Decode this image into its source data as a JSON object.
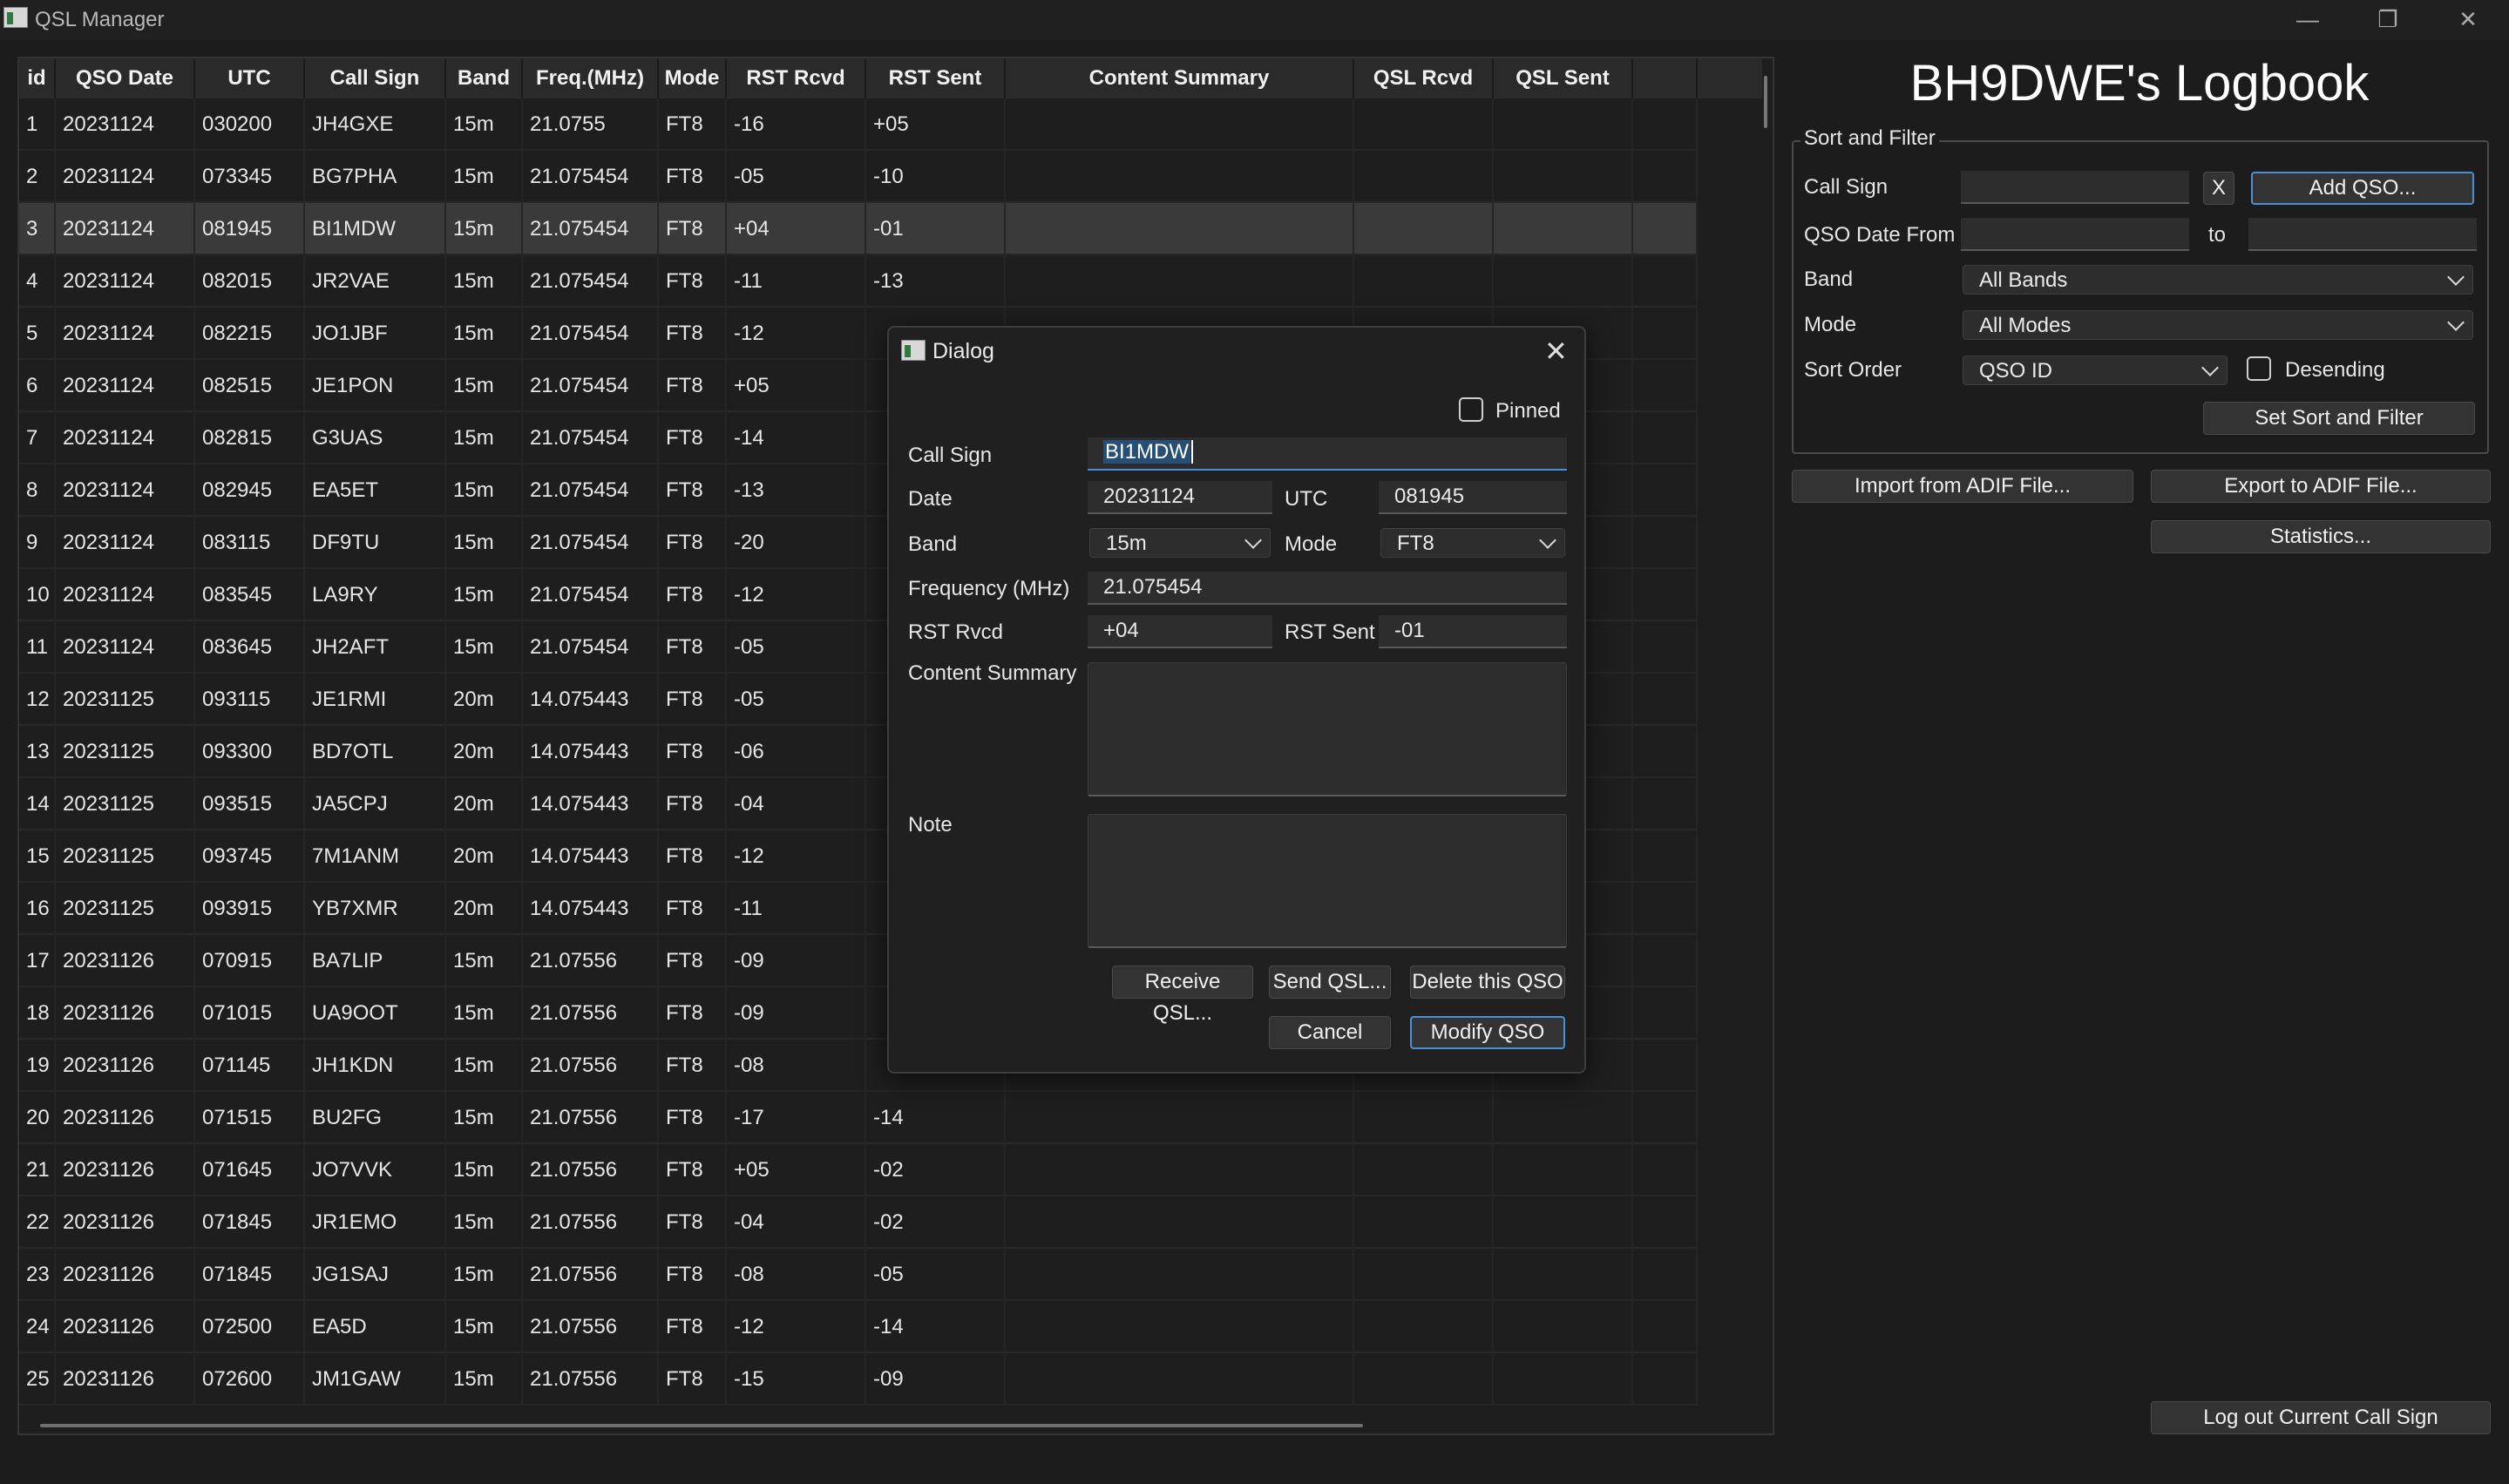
{
  "window": {
    "title": "QSL Manager",
    "minimize_glyph": "—",
    "restore_glyph": "❐",
    "close_glyph": "✕"
  },
  "table": {
    "columns": [
      "id",
      "QSO Date",
      "UTC",
      "Call Sign",
      "Band",
      "Freq.(MHz)",
      "Mode",
      "RST Rcvd",
      "RST Sent",
      "Content Summary",
      "QSL Rcvd",
      "QSL Sent"
    ],
    "rows": [
      [
        "1",
        "20231124",
        "030200",
        "JH4GXE",
        "15m",
        "21.0755",
        "FT8",
        "-16",
        "+05"
      ],
      [
        "2",
        "20231124",
        "073345",
        "BG7PHA",
        "15m",
        "21.075454",
        "FT8",
        "-05",
        "-10"
      ],
      [
        "3",
        "20231124",
        "081945",
        "BI1MDW",
        "15m",
        "21.075454",
        "FT8",
        "+04",
        "-01"
      ],
      [
        "4",
        "20231124",
        "082015",
        "JR2VAE",
        "15m",
        "21.075454",
        "FT8",
        "-11",
        "-13"
      ],
      [
        "5",
        "20231124",
        "082215",
        "JO1JBF",
        "15m",
        "21.075454",
        "FT8",
        "-12",
        ""
      ],
      [
        "6",
        "20231124",
        "082515",
        "JE1PON",
        "15m",
        "21.075454",
        "FT8",
        "+05",
        ""
      ],
      [
        "7",
        "20231124",
        "082815",
        "G3UAS",
        "15m",
        "21.075454",
        "FT8",
        "-14",
        ""
      ],
      [
        "8",
        "20231124",
        "082945",
        "EA5ET",
        "15m",
        "21.075454",
        "FT8",
        "-13",
        ""
      ],
      [
        "9",
        "20231124",
        "083115",
        "DF9TU",
        "15m",
        "21.075454",
        "FT8",
        "-20",
        ""
      ],
      [
        "10",
        "20231124",
        "083545",
        "LA9RY",
        "15m",
        "21.075454",
        "FT8",
        "-12",
        ""
      ],
      [
        "11",
        "20231124",
        "083645",
        "JH2AFT",
        "15m",
        "21.075454",
        "FT8",
        "-05",
        ""
      ],
      [
        "12",
        "20231125",
        "093115",
        "JE1RMI",
        "20m",
        "14.075443",
        "FT8",
        "-05",
        ""
      ],
      [
        "13",
        "20231125",
        "093300",
        "BD7OTL",
        "20m",
        "14.075443",
        "FT8",
        "-06",
        ""
      ],
      [
        "14",
        "20231125",
        "093515",
        "JA5CPJ",
        "20m",
        "14.075443",
        "FT8",
        "-04",
        ""
      ],
      [
        "15",
        "20231125",
        "093745",
        "7M1ANM",
        "20m",
        "14.075443",
        "FT8",
        "-12",
        ""
      ],
      [
        "16",
        "20231125",
        "093915",
        "YB7XMR",
        "20m",
        "14.075443",
        "FT8",
        "-11",
        ""
      ],
      [
        "17",
        "20231126",
        "070915",
        "BA7LIP",
        "15m",
        "21.07556",
        "FT8",
        "-09",
        ""
      ],
      [
        "18",
        "20231126",
        "071015",
        "UA9OOT",
        "15m",
        "21.07556",
        "FT8",
        "-09",
        ""
      ],
      [
        "19",
        "20231126",
        "071145",
        "JH1KDN",
        "15m",
        "21.07556",
        "FT8",
        "-08",
        ""
      ],
      [
        "20",
        "20231126",
        "071515",
        "BU2FG",
        "15m",
        "21.07556",
        "FT8",
        "-17",
        "-14"
      ],
      [
        "21",
        "20231126",
        "071645",
        "JO7VVK",
        "15m",
        "21.07556",
        "FT8",
        "+05",
        "-02"
      ],
      [
        "22",
        "20231126",
        "071845",
        "JR1EMO",
        "15m",
        "21.07556",
        "FT8",
        "-04",
        "-02"
      ],
      [
        "23",
        "20231126",
        "071845",
        "JG1SAJ",
        "15m",
        "21.07556",
        "FT8",
        "-08",
        "-05"
      ],
      [
        "24",
        "20231126",
        "072500",
        "EA5D",
        "15m",
        "21.07556",
        "FT8",
        "-12",
        "-14"
      ],
      [
        "25",
        "20231126",
        "072600",
        "JM1GAW",
        "15m",
        "21.07556",
        "FT8",
        "-15",
        "-09"
      ]
    ],
    "selected_row": 3
  },
  "panel": {
    "logbook_title": "BH9DWE's Logbook",
    "sort_filter_title": "Sort and Filter",
    "call_sign_label": "Call Sign",
    "call_sign_value": "",
    "clear_label": "X",
    "add_qso_label": "Add QSO...",
    "date_from_label": "QSO Date From",
    "date_to_label": "to",
    "band_label": "Band",
    "band_value": "All Bands",
    "mode_label": "Mode",
    "mode_value": "All Modes",
    "sort_order_label": "Sort Order",
    "sort_order_value": "QSO ID",
    "descending_label": "Desending",
    "set_sort_label": "Set Sort and Filter",
    "import_label": "Import from ADIF File...",
    "export_label": "Export to ADIF File...",
    "statistics_label": "Statistics...",
    "logout_label": "Log out Current Call Sign"
  },
  "dialog": {
    "title": "Dialog",
    "pinned_label": "Pinned",
    "call_sign_label": "Call Sign",
    "call_sign_value": "BI1MDW",
    "date_label": "Date",
    "date_value": "20231124",
    "utc_label": "UTC",
    "utc_value": "081945",
    "band_label": "Band",
    "band_value": "15m",
    "mode_label": "Mode",
    "mode_value": "FT8",
    "freq_label": "Frequency (MHz)",
    "freq_value": "21.075454",
    "rst_rcvd_label": "RST Rvcd",
    "rst_rcvd_value": "+04",
    "rst_sent_label": "RST Sent",
    "rst_sent_value": "-01",
    "content_label": "Content Summary",
    "note_label": "Note",
    "receive_qsl_label": "Receive QSL...",
    "send_qsl_label": "Send QSL...",
    "delete_label": "Delete this QSO",
    "cancel_label": "Cancel",
    "modify_label": "Modify QSO"
  },
  "colors": {
    "selection": "#264f78",
    "accent": "#4a8fd9",
    "background": "#1c1c1c"
  }
}
